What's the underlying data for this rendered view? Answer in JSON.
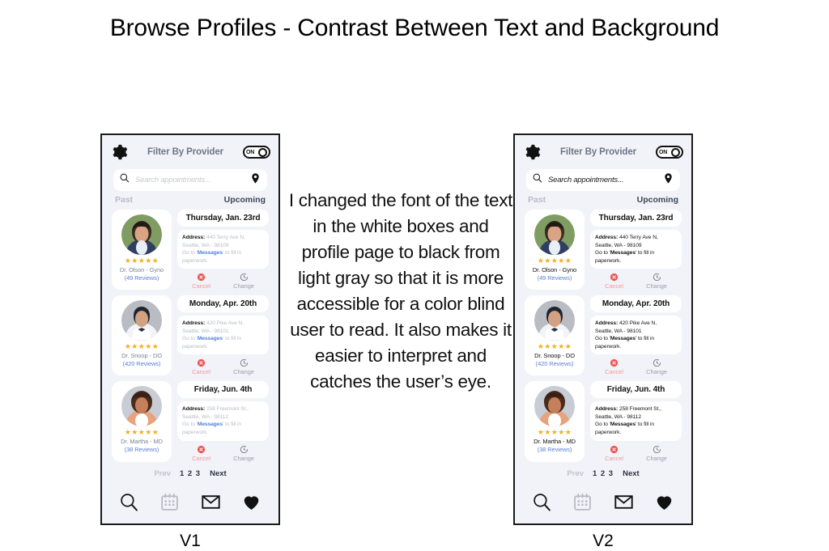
{
  "page": {
    "title": "Browse Profiles - Contrast Between Text and Background",
    "annotation": "I changed the font of the text in the white boxes and profile page to black from light gray so that it is more accessible for a color blind user to read. It also makes it easier to interpret and catches the user’s eye."
  },
  "versions": [
    {
      "caption": "V1"
    },
    {
      "caption": "V2"
    }
  ],
  "app": {
    "header": {
      "gear_icon": "gear-icon",
      "title": "Filter By Provider",
      "toggle_label": "ON"
    },
    "search": {
      "placeholder": "Search appointments...",
      "search_icon": "search-icon",
      "location_icon": "location-pin-icon"
    },
    "tabs": {
      "past": "Past",
      "upcoming": "Upcoming"
    },
    "appointments": [
      {
        "date": "Thursday, Jan. 23rd",
        "address_label": "Address:",
        "address_line1": "440 Terry Ave N,",
        "address_line2": "Seattle, WA - 98109",
        "note_prefix": "Go to '",
        "note_word": "Messages",
        "note_suffix": "' to fill in paperwork.",
        "doctor": "Dr. Olson - Gyno",
        "reviews": "(49 Reviews)",
        "stars": "★★★★★",
        "cancel_label": "Cancel",
        "change_label": "Change"
      },
      {
        "date": "Monday, Apr. 20th",
        "address_label": "Address:",
        "address_line1": "420 Pike Ave N,",
        "address_line2": "Seattle, WA - 98101",
        "note_prefix": "Go to '",
        "note_word": "Messages",
        "note_suffix": "' to fill in paperwork.",
        "doctor": "Dr. Snoop - DO",
        "reviews": "(420 Reviews)",
        "stars": "★★★★★",
        "cancel_label": "Cancel",
        "change_label": "Change"
      },
      {
        "date": "Friday, Jun. 4th",
        "address_label": "Address:",
        "address_line1": "258 Freemont St.,",
        "address_line2": "Seattle, WA - 98112",
        "note_prefix": "Go to '",
        "note_word": "Messages",
        "note_suffix": "' to fill in paperwork.",
        "doctor": "Dr. Martha - MD",
        "reviews": "(38 Reviews)",
        "stars": "★★★★★",
        "cancel_label": "Cancel",
        "change_label": "Change"
      }
    ],
    "pagination": {
      "prev": "Prev",
      "pages": "1 2 3",
      "next": "Next"
    },
    "navbar": [
      {
        "icon": "search-icon"
      },
      {
        "icon": "calendar-icon"
      },
      {
        "icon": "envelope-icon"
      },
      {
        "icon": "heart-icon"
      }
    ]
  },
  "colors": {
    "screen_bg": "#f2f3f8",
    "card_bg": "#ffffff",
    "star_gold": "#f2b01e",
    "link_blue": "#5b7fd4",
    "cancel_red": "#f09a9d",
    "muted_gray": "#b8bcc6",
    "dark_text": "#111111"
  }
}
